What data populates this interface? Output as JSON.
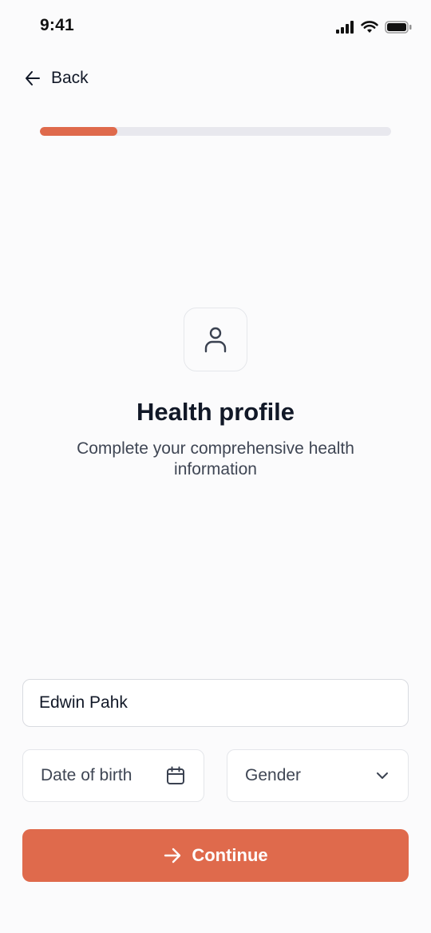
{
  "status_bar": {
    "time": "9:41",
    "icons": [
      "cellular-signal-icon",
      "wifi-icon",
      "battery-icon"
    ]
  },
  "navigation": {
    "back_label": "Back",
    "back_icon": "arrow-left-icon"
  },
  "progress": {
    "fraction": 0.22,
    "fill_color": "#df6a4c",
    "track_color": "#e8e8ee"
  },
  "header": {
    "icon": "user-icon",
    "title": "Health profile",
    "subtitle": "Complete your comprehensive health information"
  },
  "form": {
    "name": {
      "value": "Edwin Pahk"
    },
    "dob": {
      "placeholder": "Date of birth",
      "icon": "calendar-icon"
    },
    "gender": {
      "placeholder": "Gender",
      "icon": "chevron-down-icon"
    }
  },
  "actions": {
    "continue_label": "Continue",
    "continue_icon": "arrow-right-icon",
    "accent_color": "#df6a4c"
  }
}
